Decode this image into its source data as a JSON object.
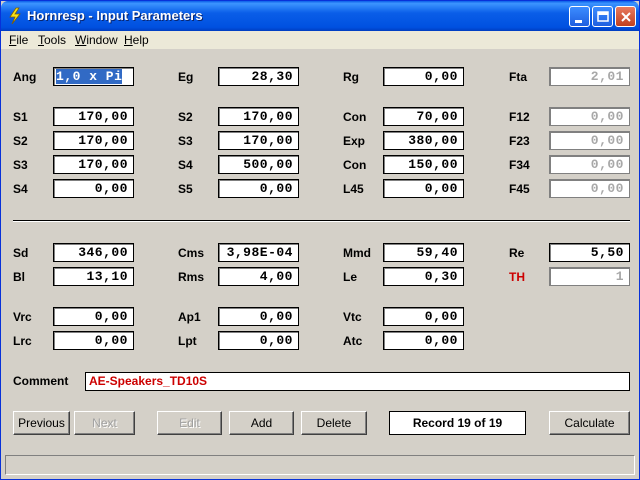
{
  "window": {
    "title": "Hornresp - Input Parameters"
  },
  "menu": [
    "File",
    "Tools",
    "Window",
    "Help"
  ],
  "fields": {
    "Ang": "1,0 x Pi",
    "Eg": "28,30",
    "Rg": "0,00",
    "Fta": "2,01",
    "S1a": "170,00",
    "S2b": "170,00",
    "Con1": "70,00",
    "F12": "0,00",
    "S2a": "170,00",
    "S3b": "170,00",
    "Exp": "380,00",
    "F23": "0,00",
    "S3a": "170,00",
    "S4b": "500,00",
    "Con2": "150,00",
    "F34": "0,00",
    "S4a": "0,00",
    "S5": "0,00",
    "L45": "0,00",
    "F45": "0,00",
    "Sd": "346,00",
    "Cms": "3,98E-04",
    "Mmd": "59,40",
    "Re": "5,50",
    "Bl": "13,10",
    "Rms": "4,00",
    "Le": "0,30",
    "TH": "1",
    "Vrc": "0,00",
    "Ap1": "0,00",
    "Vtc": "0,00",
    "Lrc": "0,00",
    "Lpt": "0,00",
    "Atc": "0,00"
  },
  "labels": {
    "Ang": "Ang",
    "Eg": "Eg",
    "Rg": "Rg",
    "Fta": "Fta",
    "S1a": "S1",
    "S2b": "S2",
    "Con1": "Con",
    "F12": "F12",
    "S2a": "S2",
    "S3b": "S3",
    "Exp": "Exp",
    "F23": "F23",
    "S3a": "S3",
    "S4b": "S4",
    "Con2": "Con",
    "F34": "F34",
    "S4a": "S4",
    "S5": "S5",
    "L45": "L45",
    "F45": "F45",
    "Sd": "Sd",
    "Cms": "Cms",
    "Mmd": "Mmd",
    "Re": "Re",
    "Bl": "Bl",
    "Rms": "Rms",
    "Le": "Le",
    "TH": "TH",
    "Vrc": "Vrc",
    "Ap1": "Ap1",
    "Vtc": "Vtc",
    "Lrc": "Lrc",
    "Lpt": "Lpt",
    "Atc": "Atc",
    "Comment": "Comment"
  },
  "comment": "AE-Speakers_TD10S",
  "buttons": {
    "previous": "Previous",
    "next": "Next",
    "edit": "Edit",
    "add": "Add",
    "delete": "Delete",
    "calculate": "Calculate"
  },
  "record": "Record 19 of 19",
  "colors": {
    "titlebar": "#0a5ee8",
    "highlight": "#cc0000",
    "selection": "#316ac5"
  },
  "icons": [
    "app-icon",
    "minimize-icon",
    "maximize-icon",
    "close-icon"
  ]
}
